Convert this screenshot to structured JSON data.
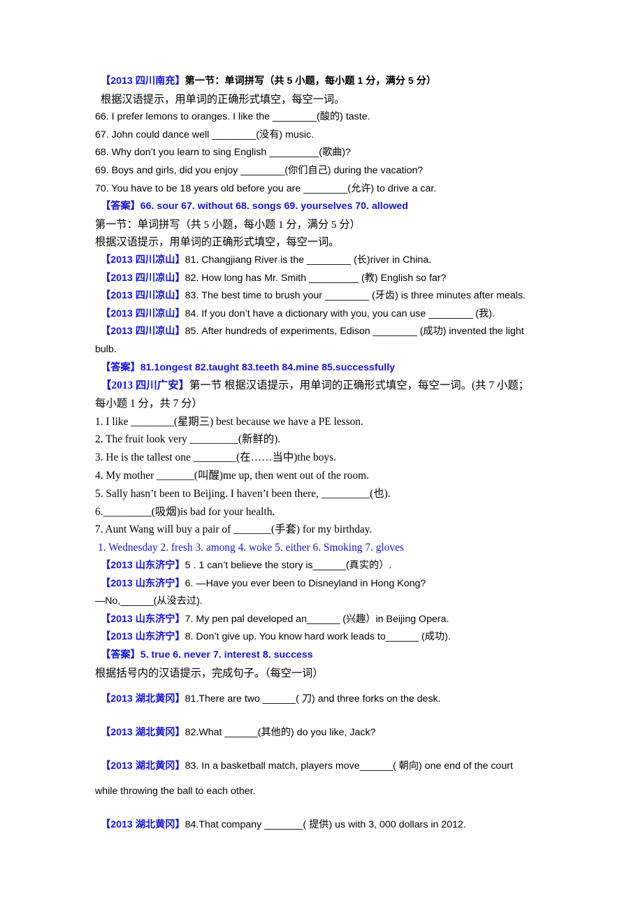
{
  "document": {
    "sections": [
      {
        "id": "nanchong",
        "tag": "【2013 四川南充】",
        "heading": "第一节：单词拼写（共 5 小题，每小题 1 分，满分 5 分）",
        "instruction": "根据汉语提示，用单词的正确形式填空，每空一词。",
        "items": [
          "66. I prefer lemons to oranges. I like the ________(酸的) taste.",
          "67. John could dance well ________(没有) music.",
          "68. Why don’t you learn to sing English _________(歌曲)?",
          "69. Boys and girls, did you enjoy ________(你们自己) during the vacation?",
          "70. You have to be 18 years old before you are ________(允许) to drive a car."
        ],
        "answer_label": "【答案】",
        "answer_body": "66. sour    67. without    68. songs    69. yourselves    70. allowed"
      },
      {
        "id": "liangshan",
        "heading": "第一节：单词拼写（共 5 小题，每小题 1 分，满分 5 分）",
        "instruction": "根据汉语提示，用单词的正确形式填空，每空一词。",
        "tag": "【2013 四川凉山】",
        "items": [
          "81. Changjiang River is the ________ (长)river in China.",
          "82. How long has Mr. Smith _________ (教) English so far?",
          "83. The best time to brush your ________ (牙齿) is three minutes after meals.",
          "84. If you don’t have a dictionary with you, you can use ________ (我).",
          "85. After hundreds of experiments, Edison ________ (成功) invented the light"
        ],
        "continuation": "bulb.",
        "answer_label": "【答案】",
        "answer_body": "81.1ongest    82.taught    83.teeth 84.mine 85.successfully"
      },
      {
        "id": "guangan",
        "tag": "【2013 四川广安】",
        "heading": "第一节 根据汉语提示，用单词的正确形式填空，每空一词。(共 7 小题；",
        "heading_line2": "每小题 1 分，共 7 分）",
        "items": [
          "1. I like ________(星期三) best because we have a PE lesson.",
          "2. The fruit look very _________(新鲜的).",
          "3. He is the tallest one ________(在……当中)the boys.",
          "4. My mother _______(叫醒)me up, then went out of the room.",
          "5. Sally hasn’t been to Beijing. I haven’t been there, _________(也).",
          "6._________(吸烟)is bad for your health.",
          "7. Aunt Wang will buy a pair of _______(手套) for my birthday."
        ],
        "answer_body": "1. Wednesday   2. fresh   3. among   4. woke 5. either   6. Smoking 7. gloves"
      },
      {
        "id": "jining",
        "tag": "【2013 山东济宁】",
        "items": [
          "5 . 1 can’t believe the story is______(真实的）.",
          "6. —Have you ever been to Disneyland in Hong Kong?",
          "7. My pen pal developed an______ (兴趣）in Beijing Opera.",
          "8. Don’t give up. You know hard work leads to______ (成功)."
        ],
        "continuation": "—No,______(从没去过).",
        "answer_label": "【答案】",
        "answer_body": "5. true 6. never 7. interest 8. success",
        "closing_instruction": "根据括号内的汉语提示，完成句子。（每空一词）"
      },
      {
        "id": "huanggang",
        "tag": "【2013  湖北黄冈】",
        "items": [
          "81.There are two ______(  刀) and three forks on the desk.",
          "82.What ______(其他的) do you like, Jack?",
          "83. In a basketball match, players move______(  朝向) one end of the court",
          "84.That company _______(  提供) us with 3, 000 dollars in 2012."
        ],
        "continuation": "while throwing the ball to each other."
      }
    ]
  }
}
